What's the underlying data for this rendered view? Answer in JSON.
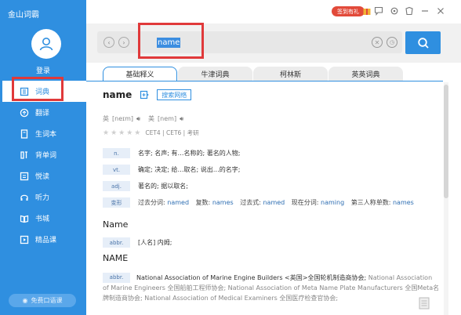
{
  "app": {
    "title": "金山词霸"
  },
  "sidebar": {
    "login_label": "登录",
    "items": [
      {
        "label": "词典",
        "icon": "dictionary-icon",
        "active": true
      },
      {
        "label": "翻译",
        "icon": "translate-icon",
        "active": false
      },
      {
        "label": "生词本",
        "icon": "wordbook-icon",
        "active": false
      },
      {
        "label": "背单词",
        "icon": "memorize-icon",
        "active": false
      },
      {
        "label": "悦读",
        "icon": "reading-icon",
        "active": false
      },
      {
        "label": "听力",
        "icon": "headphones-icon",
        "active": false
      },
      {
        "label": "书城",
        "icon": "bookstore-icon",
        "active": false
      },
      {
        "label": "精品课",
        "icon": "course-icon",
        "active": false
      }
    ],
    "oral_label": "免费口语课"
  },
  "topbar": {
    "sign_badge": "签到有礼"
  },
  "search": {
    "value": "name"
  },
  "tabs": [
    "基础释义",
    "牛津词典",
    "柯林斯",
    "英英词典"
  ],
  "entry": {
    "word": "name",
    "web_search": "搜索网络",
    "phonetic_uk_label": "英",
    "phonetic_uk": "[neɪm]",
    "phonetic_us_label": "美",
    "phonetic_us": "[nem]",
    "stars": "★★★★★",
    "tags": "CET4 | CET6 | 考研",
    "definitions": [
      {
        "pos": "n.",
        "text": "名字; 名声; 有…名称的; 著名的人物;"
      },
      {
        "pos": "vt.",
        "text": "确定; 决定; 给…取名; 说出…的名字;"
      },
      {
        "pos": "adj.",
        "text": "著名的; 据以取名;"
      }
    ],
    "forms_pos": "变形",
    "forms": [
      {
        "label": "过去分词:",
        "value": "named"
      },
      {
        "label": "复数:",
        "value": "names"
      },
      {
        "label": "过去式:",
        "value": "named"
      },
      {
        "label": "现在分词:",
        "value": "naming"
      },
      {
        "label": "第三人称单数:",
        "value": "names"
      }
    ]
  },
  "related": [
    {
      "word": "Name",
      "pos": "abbr.",
      "text": "[人名] 内姆;"
    },
    {
      "word": "NAME",
      "pos": "abbr.",
      "first": "National Association of Marine Engine Builders <英国>全国轮机制造商协会;",
      "rest": "National Association of Marine Engineers 全国船舶工程师协会; National Association of Meta Name Plate Manufacturers 全国Meta名牌制造商协会; National Association of Medical Examiners 全国医疗检查官协会;"
    }
  ],
  "colors": {
    "accent": "#2f8fe0",
    "highlight": "#e0393a"
  }
}
